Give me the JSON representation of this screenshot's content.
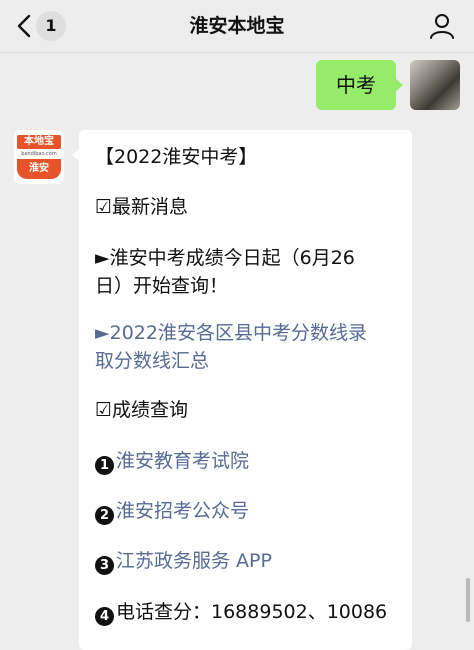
{
  "nav": {
    "back_count": "1",
    "title": "淮安本地宝"
  },
  "outgoing": {
    "text": "中考"
  },
  "incoming": {
    "avatar": {
      "logo_top": "本地宝",
      "logo_sub": "bendibao.com",
      "logo_bottom": "淮安"
    },
    "title": "【2022淮安中考】",
    "section1": "☑最新消息",
    "news1_line1": "►淮安中考成绩今日起（6月26",
    "news1_line2": "日）开始查询！",
    "news2_line1": "►2022淮安各区县中考分数线录",
    "news2_line2": "取分数线汇总",
    "section2": "☑成绩查询",
    "items": [
      {
        "num": "1",
        "text": "淮安教育考试院"
      },
      {
        "num": "2",
        "text": "淮安招考公众号"
      },
      {
        "num": "3",
        "text": "江苏政务服务 APP"
      },
      {
        "num": "4",
        "text": "电话查分：16889502、10086"
      }
    ]
  }
}
